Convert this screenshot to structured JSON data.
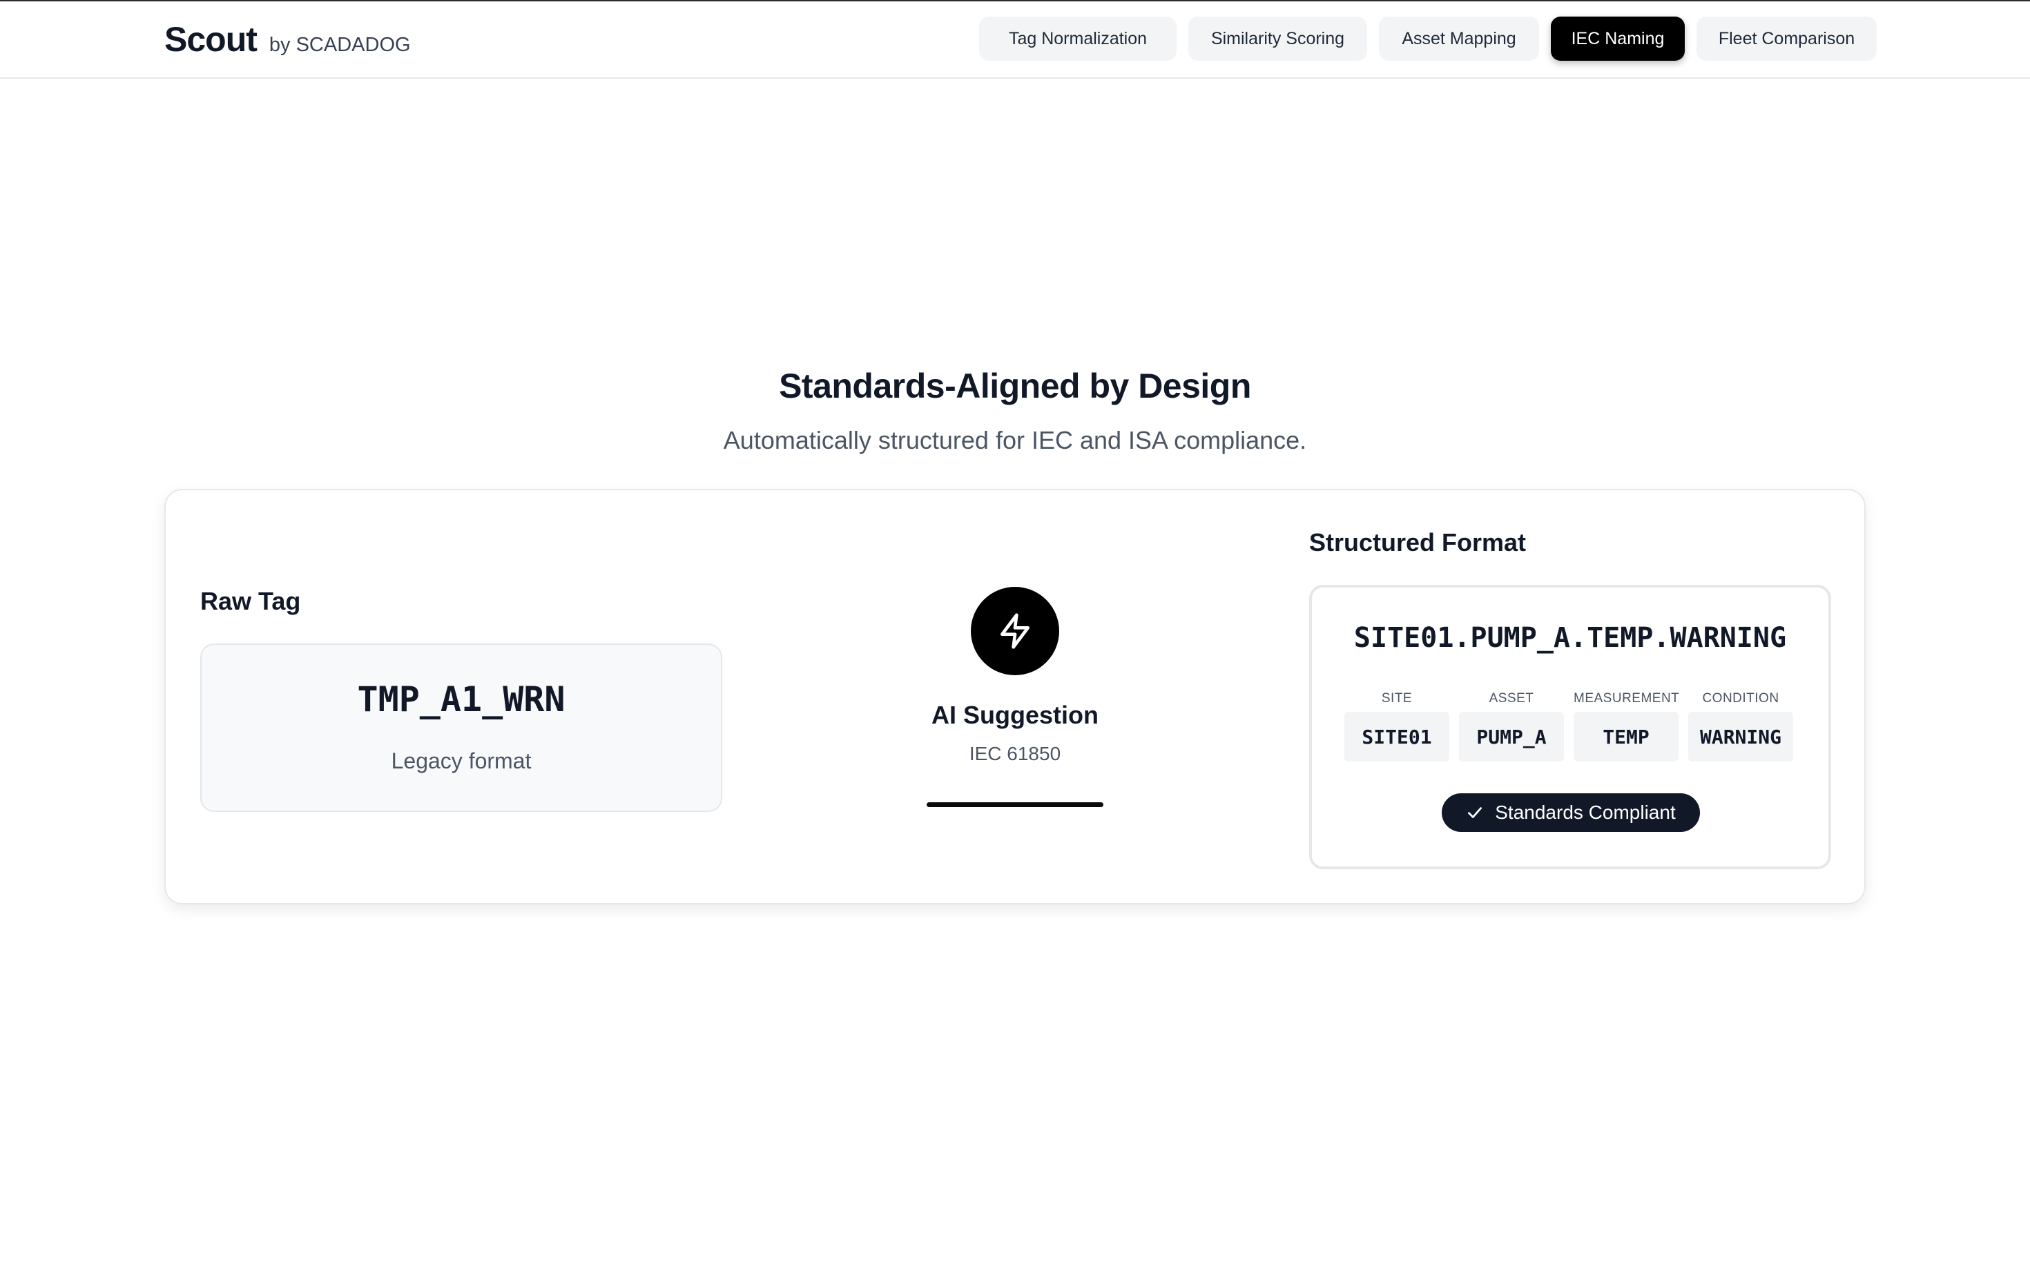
{
  "header": {
    "brand_name": "Scout",
    "brand_by": "by SCADADOG",
    "nav": [
      {
        "label": "Tag Normalization",
        "active": false
      },
      {
        "label": "Similarity Scoring",
        "active": false
      },
      {
        "label": "Asset Mapping",
        "active": false
      },
      {
        "label": "IEC Naming",
        "active": true
      },
      {
        "label": "Fleet Comparison",
        "active": false
      }
    ]
  },
  "hero": {
    "title": "Standards-Aligned by Design",
    "subtitle": "Automatically structured for IEC and ISA compliance."
  },
  "raw": {
    "label": "Raw Tag",
    "tag": "TMP_A1_WRN",
    "description": "Legacy format"
  },
  "ai": {
    "icon": "lightning-icon",
    "label": "AI Suggestion",
    "standard": "IEC 61850"
  },
  "structured": {
    "label": "Structured Format",
    "tag": "SITE01.PUMP_A.TEMP.WARNING",
    "segments": [
      {
        "label": "SITE",
        "value": "SITE01"
      },
      {
        "label": "ASSET",
        "value": "PUMP_A"
      },
      {
        "label": "MEASUREMENT",
        "value": "TEMP"
      },
      {
        "label": "CONDITION",
        "value": "WARNING"
      }
    ],
    "badge": "Standards Compliant",
    "badge_icon": "check-icon"
  },
  "colors": {
    "accent": "#000000",
    "badge_bg": "#111827",
    "text_primary": "#111827",
    "text_secondary": "#4b5563",
    "surface": "#f3f4f6",
    "border": "#e5e7eb"
  }
}
